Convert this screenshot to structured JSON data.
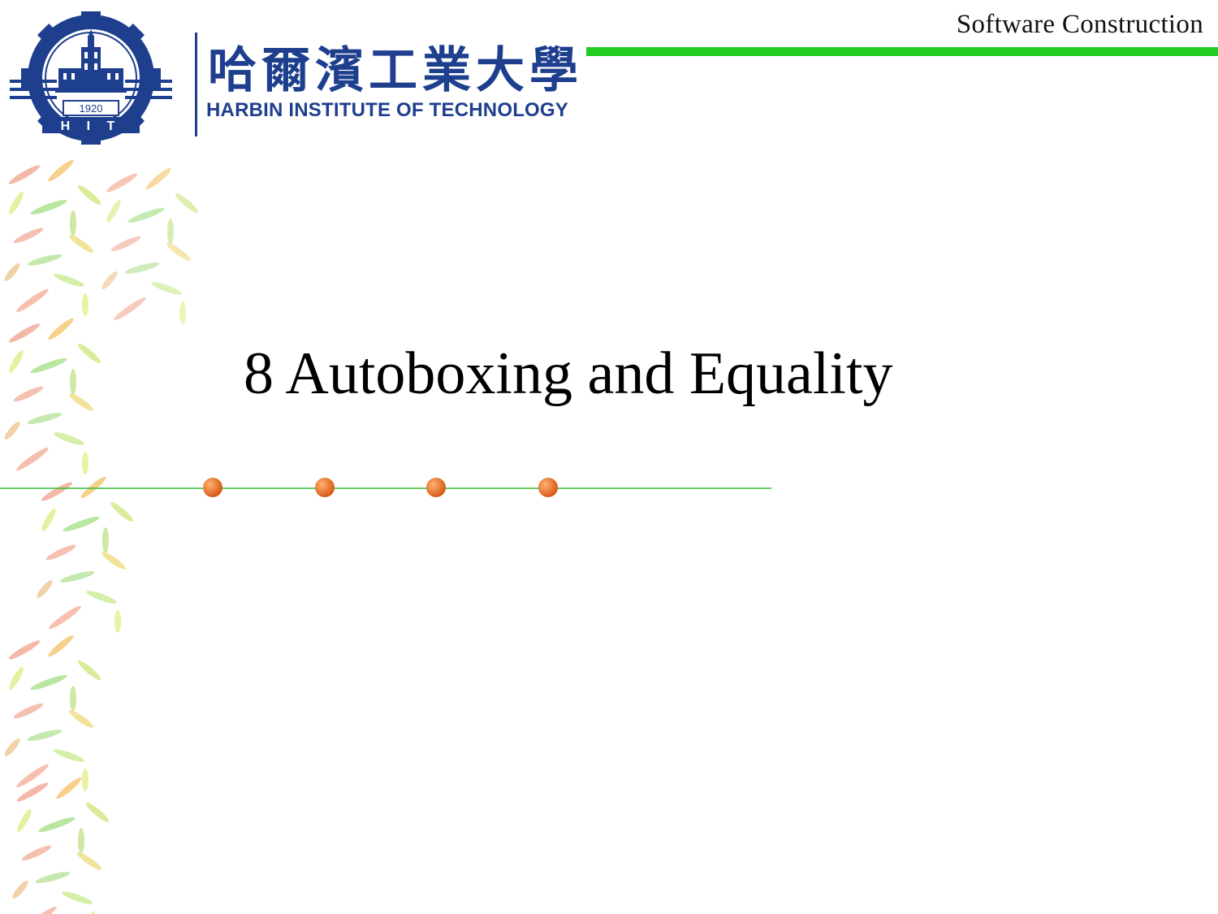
{
  "header": {
    "course_label": "Software Construction",
    "accent_color": "#22cc22"
  },
  "logo": {
    "emblem_year": "1920",
    "emblem_letters": "H I T",
    "chinese_name": "哈爾濱工業大學",
    "english_name": "HARBIN INSTITUTE OF TECHNOLOGY",
    "brand_color": "#1e3f8e"
  },
  "slide": {
    "title": "8 Autoboxing and Equality"
  },
  "decoration": {
    "dot_color": "#e8651a",
    "line_color": "#33bb33",
    "dot_count": 4
  }
}
